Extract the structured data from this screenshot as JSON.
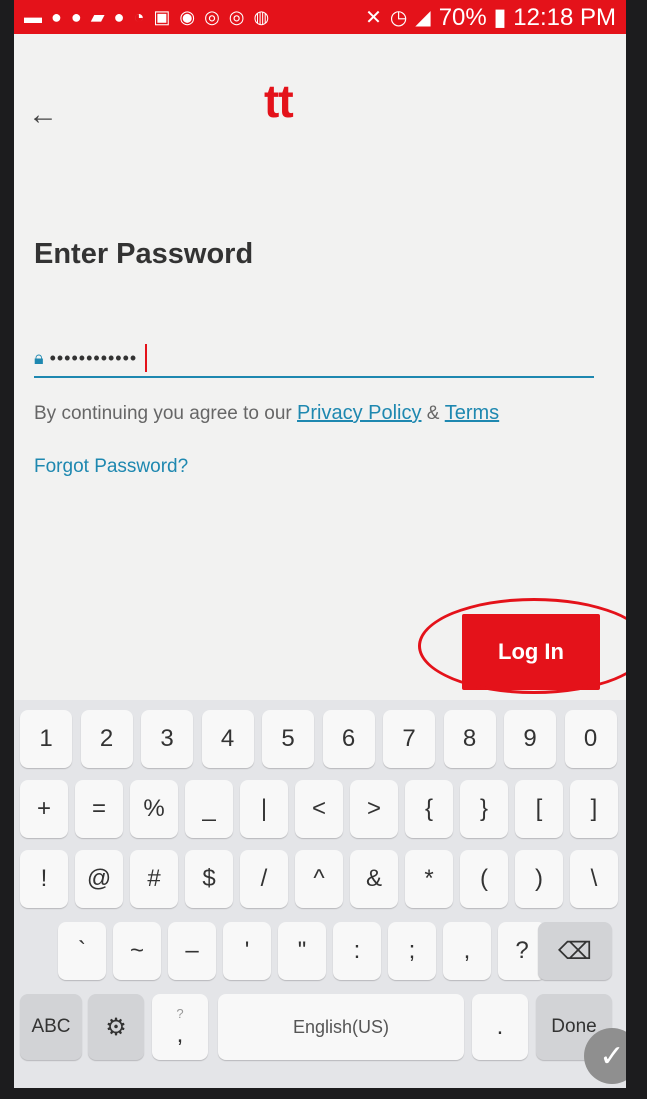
{
  "status_bar": {
    "left_icons": [
      "message-icon",
      "s-icon",
      "v-icon",
      "app-icon",
      "v-icon",
      "wifi-icon",
      "image-icon",
      "chat-icon",
      "fingerprint-icon",
      "fingerprint-icon",
      "chrome-icon"
    ],
    "right_text": "70% ▮ 12:18 PM",
    "background_color": "#e4121a"
  },
  "header": {
    "logo_text": "tt",
    "back_icon": "arrow-left-icon",
    "brand_color": "#e4121a"
  },
  "form": {
    "title": "Enter Password",
    "password_value": "••••••••••••",
    "agree_prefix": "By continuing you agree to our ",
    "privacy_link": "Privacy Policy",
    "amp": " & ",
    "terms_link": "Terms",
    "forgot_link": "Forgot Password?",
    "link_color": "#1e88b0"
  },
  "login_button": {
    "label": "Log In"
  },
  "keyboard": {
    "row1": [
      "1",
      "2",
      "3",
      "4",
      "5",
      "6",
      "7",
      "8",
      "9",
      "0"
    ],
    "row2": [
      "+",
      "=",
      "%",
      "_",
      "|",
      "<",
      ">",
      "{",
      "}",
      "[",
      "]"
    ],
    "row3": [
      "!",
      "@",
      "#",
      "$",
      "/",
      "^",
      "&",
      "*",
      "(",
      ")",
      "\\"
    ],
    "row4": [
      "`",
      "~",
      "–",
      "'",
      "\"",
      ":",
      ";",
      ",",
      "?"
    ],
    "abc_label": "ABC",
    "comma_hint": "?",
    "comma": ",",
    "space_label": "English(US)",
    "period": ".",
    "done_label": "Done"
  }
}
